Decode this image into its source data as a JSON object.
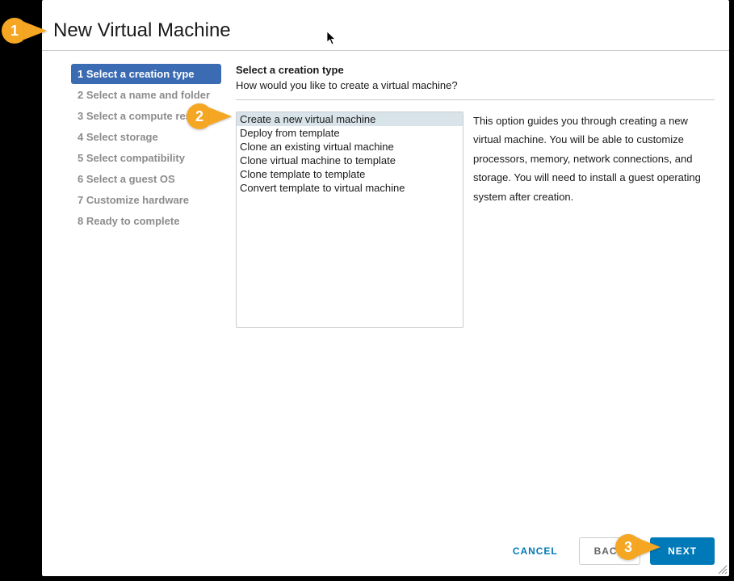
{
  "title": "New Virtual Machine",
  "steps": [
    {
      "label": "1 Select a creation type",
      "active": true
    },
    {
      "label": "2 Select a name and folder",
      "active": false
    },
    {
      "label": "3 Select a compute resource",
      "active": false
    },
    {
      "label": "4 Select storage",
      "active": false
    },
    {
      "label": "5 Select compatibility",
      "active": false
    },
    {
      "label": "6 Select a guest OS",
      "active": false
    },
    {
      "label": "7 Customize hardware",
      "active": false
    },
    {
      "label": "8 Ready to complete",
      "active": false
    }
  ],
  "content": {
    "heading": "Select a creation type",
    "subheading": "How would you like to create a virtual machine?",
    "options": [
      {
        "label": "Create a new virtual machine",
        "selected": true
      },
      {
        "label": "Deploy from template",
        "selected": false
      },
      {
        "label": "Clone an existing virtual machine",
        "selected": false
      },
      {
        "label": "Clone virtual machine to template",
        "selected": false
      },
      {
        "label": "Clone template to template",
        "selected": false
      },
      {
        "label": "Convert template to virtual machine",
        "selected": false
      }
    ],
    "description": "This option guides you through creating a new virtual machine. You will be able to customize processors, memory, network connections, and storage. You will need to install a guest operating system after creation."
  },
  "footer": {
    "cancel": "CANCEL",
    "back": "BACK",
    "next": "NEXT"
  },
  "callouts": [
    {
      "n": "1"
    },
    {
      "n": "2"
    },
    {
      "n": "3"
    }
  ]
}
